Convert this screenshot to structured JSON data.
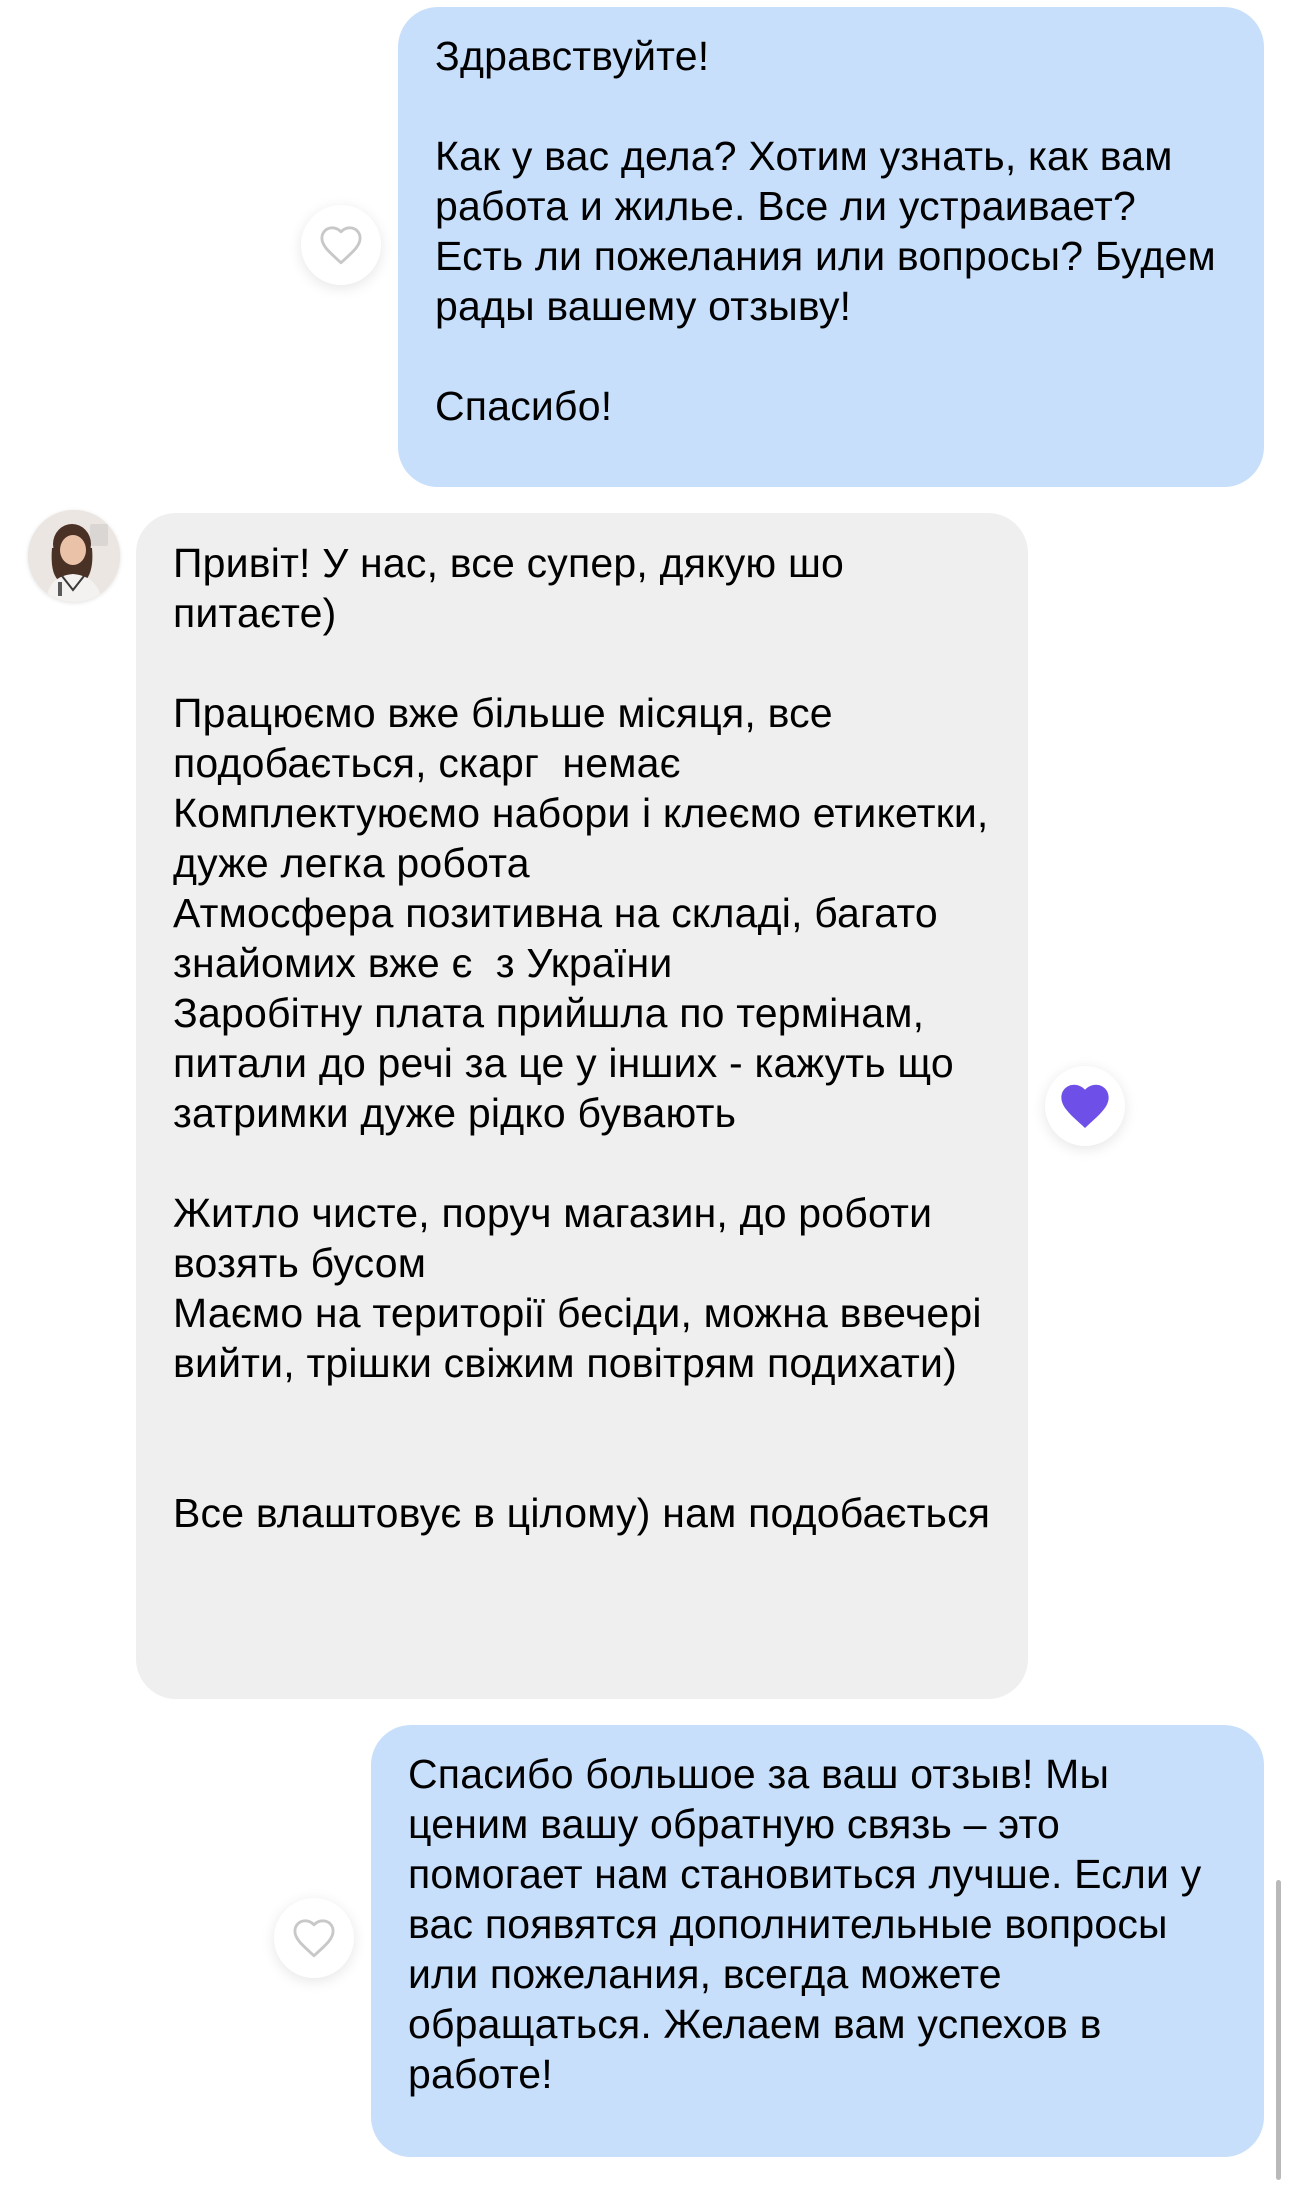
{
  "messages": [
    {
      "direction": "outgoing",
      "text": "Здравствуйте!\n\nКак у вас дела? Хотим узнать, как вам работа и жилье. Все ли устраивает? Есть ли пожелания или вопросы? Будем рады вашему отзыву!\n\nСпасибо!",
      "reaction": {
        "icon": "heart-outline-icon",
        "active": false
      }
    },
    {
      "direction": "incoming",
      "text": "Привіт! У нас, все супер, дякую шо питаєте)\n\nПрацюємо вже більше місяця, все подобається, скарг  немає\nКомплектуюємо набори і клеємо етикетки, дуже легка робота\nАтмосфера позитивна на складі, багато знайомих вже є  з України\nЗаробітну плата прийшла по термінам, питали до речі за це у інших - кажуть що затримки дуже рідко бувають\n\nЖитло чисте, поруч магазин, до роботи возять бусом\nМаємо на території бесіди, можна ввечері вийти, трішки свіжим повітрям подихати)\n\n\nВсе влаштовує в цілому) нам подобається",
      "reaction": {
        "icon": "heart-filled-icon",
        "active": true,
        "color": "#6e50e8"
      }
    },
    {
      "direction": "outgoing",
      "text": "Спасибо большое за ваш отзыв! Мы ценим вашу обратную связь – это помогает нам становиться лучше. Если у вас появятся дополнительные вопросы или пожелания, всегда можете обращаться. Желаем вам успехов в работе!",
      "reaction": {
        "icon": "heart-outline-icon",
        "active": false
      }
    }
  ],
  "colors": {
    "outgoing_bubble": "#c7dffb",
    "incoming_bubble": "#efefef",
    "heart_active": "#6e50e8",
    "heart_outline": "#c8c8c8"
  },
  "avatar": {
    "icon": "user-avatar"
  }
}
